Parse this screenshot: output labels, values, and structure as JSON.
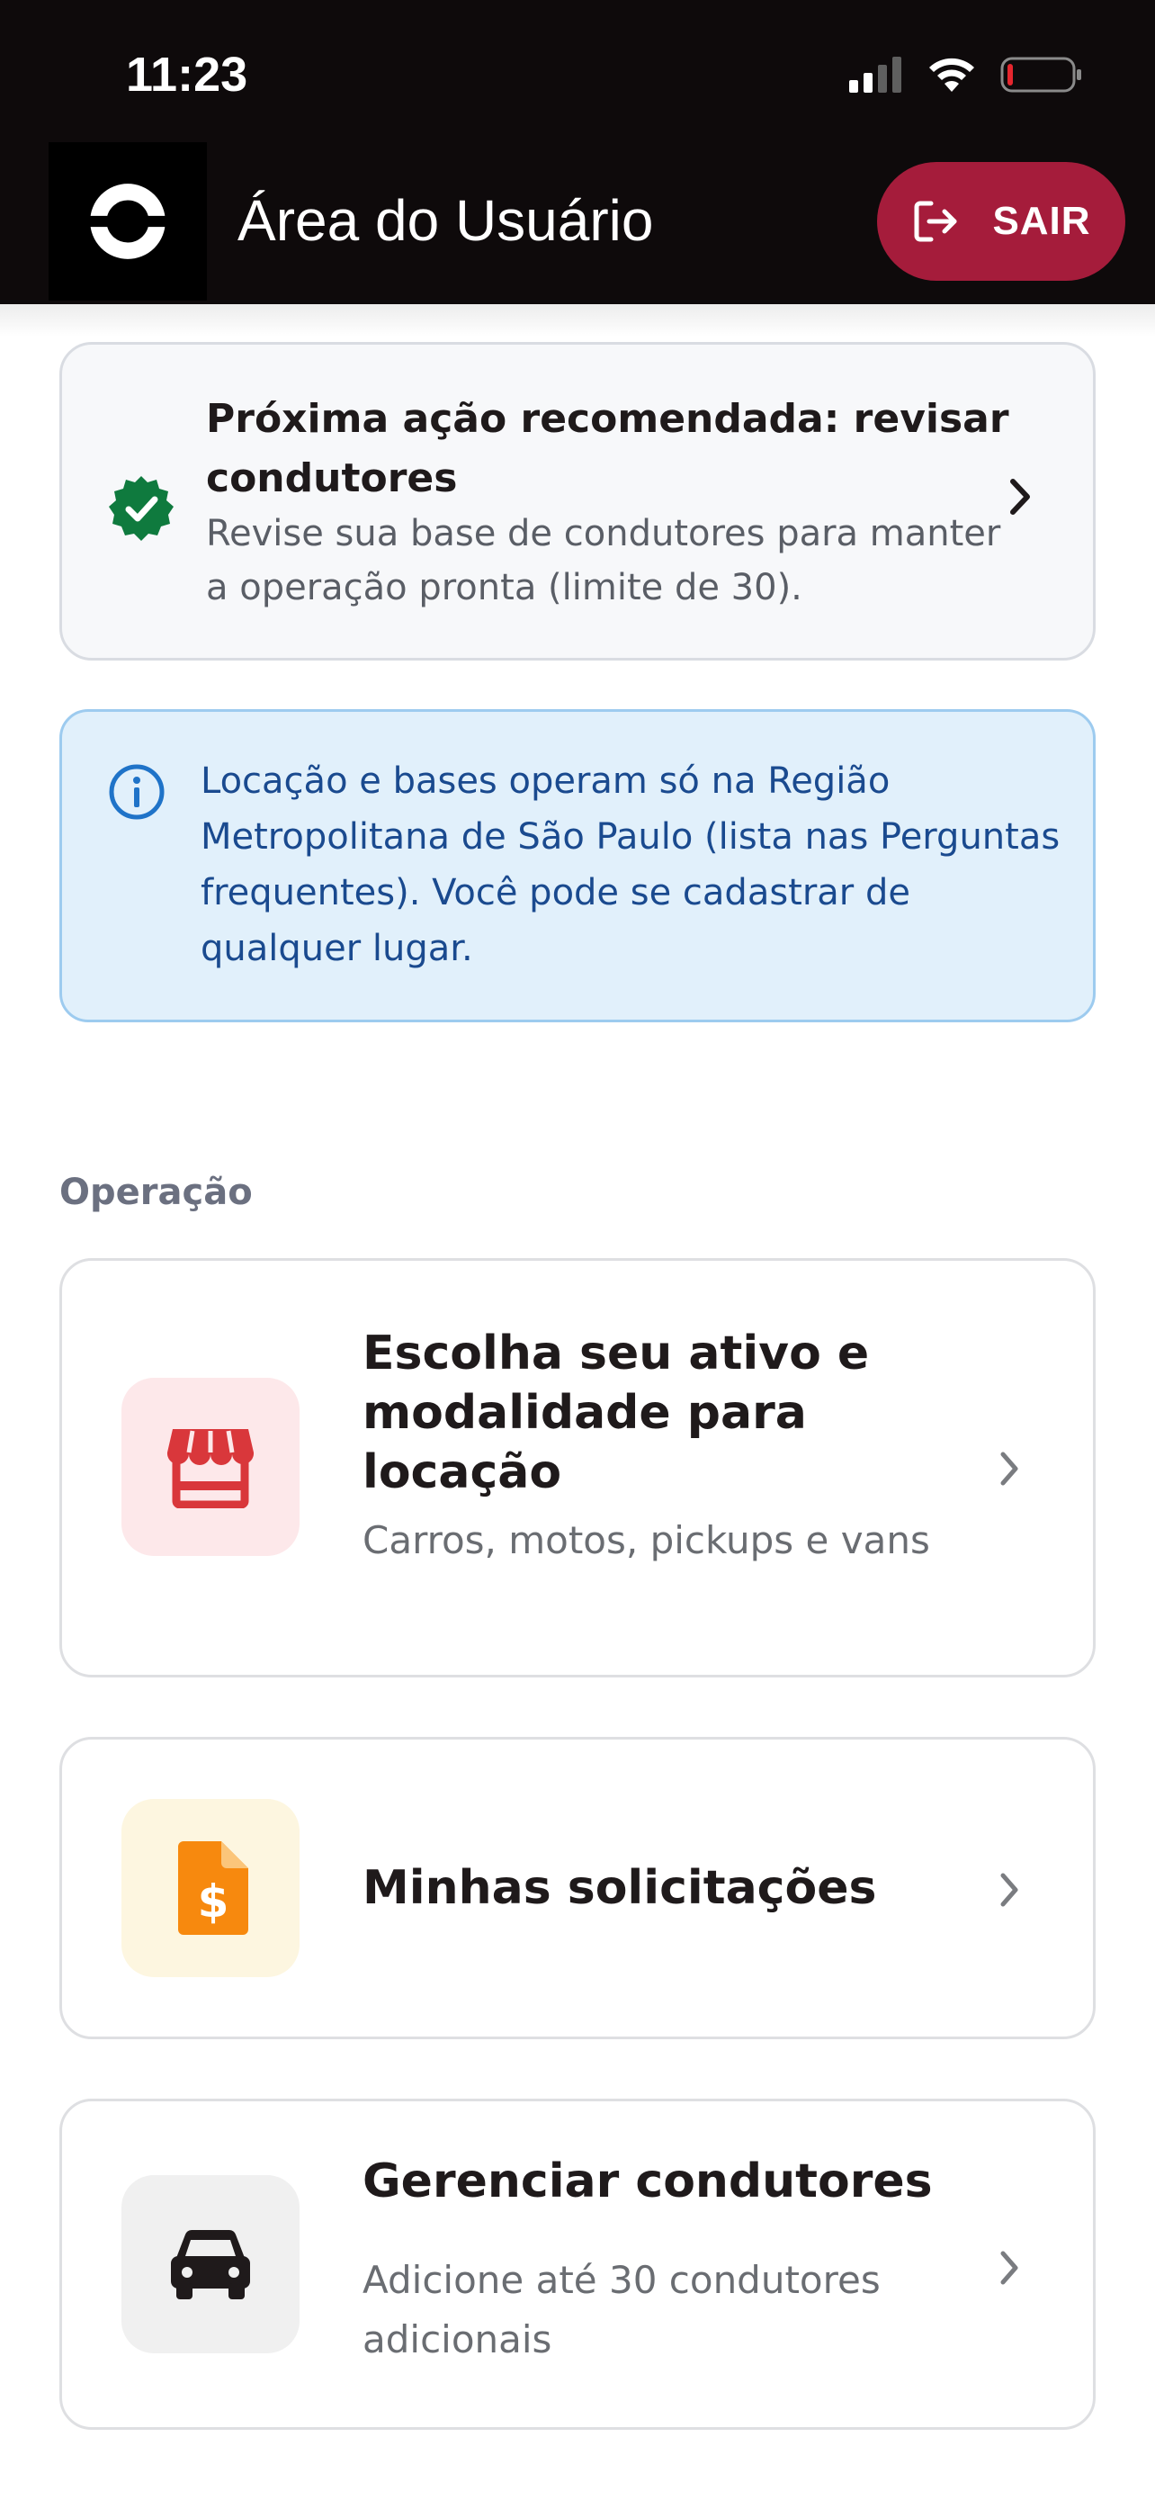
{
  "status_bar": {
    "time": "11:23"
  },
  "header": {
    "title": "Área do Usuário",
    "logout_label": "SAIR"
  },
  "recommendation": {
    "title": "Próxima ação recomendada: revisar condutores",
    "text": "Revise sua base de condutores para manter a operação pronta (limite de 30)."
  },
  "info_notice": {
    "text": "Locação e bases operam só na Região Metropolitana de São Paulo (lista nas Perguntas frequentes). Você pode se cadastrar de qualquer lugar."
  },
  "section": {
    "label": "Operação"
  },
  "menu": [
    {
      "title": "Escolha seu ativo e modalidade para locação",
      "subtitle": "Carros, motos, pickups e vans",
      "icon": "storefront-icon"
    },
    {
      "title": "Minhas solicitações",
      "icon": "invoice-dollar-icon"
    },
    {
      "title": "Gerenciar condutores",
      "subtitle": "Adicione até 30 condutores adicionais",
      "icon": "car-icon"
    }
  ],
  "colors": {
    "header_bg": "#0e0a0b",
    "logout_bg": "#a51c3b",
    "badge_green": "#0f7a3e",
    "info_bg": "#e1f0fb",
    "info_text": "#1a4a8f",
    "store_icon": "#d9373b",
    "store_icon_bg": "#fde8ea",
    "invoice_icon": "#f7890e",
    "invoice_icon_bg": "#fdf6e0",
    "car_icon_bg": "#f0f0f0"
  }
}
